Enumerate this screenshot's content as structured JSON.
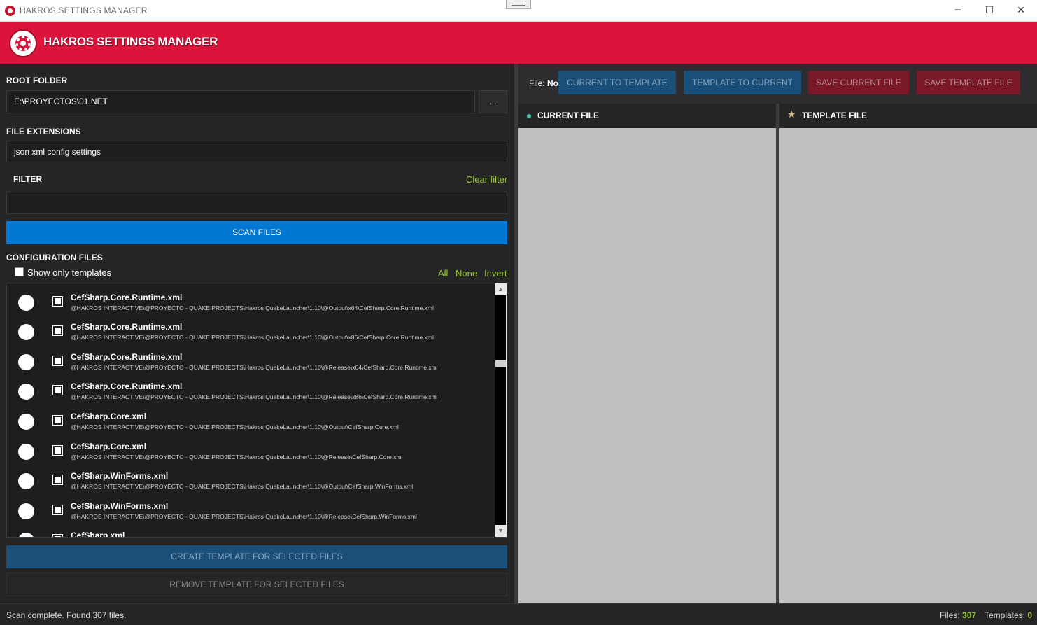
{
  "window": {
    "title": "HAKROS SETTINGS MANAGER",
    "minimize": "─",
    "maximize": "☐",
    "close": "✕"
  },
  "header": {
    "brand": "HAKROS SETTINGS MANAGER"
  },
  "root_folder": {
    "label": "ROOT FOLDER",
    "value": "E:\\PROYECTOS\\01.NET",
    "browse_label": "..."
  },
  "file_extensions": {
    "label": "FILE EXTENSIONS",
    "value": "json xml config settings"
  },
  "filter": {
    "label": "FILTER",
    "value": "",
    "clear_label": "Clear filter"
  },
  "scan_button": "SCAN FILES",
  "config_files": {
    "label": "CONFIGURATION FILES",
    "show_only_templates": "Show only templates",
    "select_all": "All",
    "select_none": "None",
    "select_invert": "Invert",
    "files": [
      {
        "name": "CefSharp.Core.Runtime.xml",
        "path": "@HAKROS INTERACTIVE\\@PROYECTO - QUAKE PROJECTS\\Hakros QuakeLauncher\\1.10\\@Output\\x64\\CefSharp.Core.Runtime.xml"
      },
      {
        "name": "CefSharp.Core.Runtime.xml",
        "path": "@HAKROS INTERACTIVE\\@PROYECTO - QUAKE PROJECTS\\Hakros QuakeLauncher\\1.10\\@Output\\x86\\CefSharp.Core.Runtime.xml"
      },
      {
        "name": "CefSharp.Core.Runtime.xml",
        "path": "@HAKROS INTERACTIVE\\@PROYECTO - QUAKE PROJECTS\\Hakros QuakeLauncher\\1.10\\@Release\\x64\\CefSharp.Core.Runtime.xml"
      },
      {
        "name": "CefSharp.Core.Runtime.xml",
        "path": "@HAKROS INTERACTIVE\\@PROYECTO - QUAKE PROJECTS\\Hakros QuakeLauncher\\1.10\\@Release\\x86\\CefSharp.Core.Runtime.xml"
      },
      {
        "name": "CefSharp.Core.xml",
        "path": "@HAKROS INTERACTIVE\\@PROYECTO - QUAKE PROJECTS\\Hakros QuakeLauncher\\1.10\\@Output\\CefSharp.Core.xml"
      },
      {
        "name": "CefSharp.Core.xml",
        "path": "@HAKROS INTERACTIVE\\@PROYECTO - QUAKE PROJECTS\\Hakros QuakeLauncher\\1.10\\@Release\\CefSharp.Core.xml"
      },
      {
        "name": "CefSharp.WinForms.xml",
        "path": "@HAKROS INTERACTIVE\\@PROYECTO - QUAKE PROJECTS\\Hakros QuakeLauncher\\1.10\\@Output\\CefSharp.WinForms.xml"
      },
      {
        "name": "CefSharp.WinForms.xml",
        "path": "@HAKROS INTERACTIVE\\@PROYECTO - QUAKE PROJECTS\\Hakros QuakeLauncher\\1.10\\@Release\\CefSharp.WinForms.xml"
      },
      {
        "name": "CefSharp.xml",
        "path": ""
      }
    ]
  },
  "create_template_button": "CREATE TEMPLATE FOR SELECTED FILES",
  "remove_template_button": "REMOVE TEMPLATE FOR SELECTED FILES",
  "toolbar": {
    "file_prefix": "File:",
    "file_value": "No",
    "current_to_template": "CURRENT TO TEMPLATE",
    "template_to_current": "TEMPLATE TO CURRENT",
    "save_current": "SAVE CURRENT FILE",
    "save_template": "SAVE TEMPLATE FILE"
  },
  "panes": {
    "current_title": "CURRENT FILE",
    "template_title": "TEMPLATE FILE"
  },
  "status": {
    "message": "Scan complete. Found 307 files.",
    "files_label": "Files:",
    "files_count": "307",
    "templates_label": "Templates:",
    "templates_count": "0"
  },
  "colors": {
    "accent_red": "#dc143c",
    "accent_blue": "#0078d4",
    "link_green": "#9acd32"
  }
}
